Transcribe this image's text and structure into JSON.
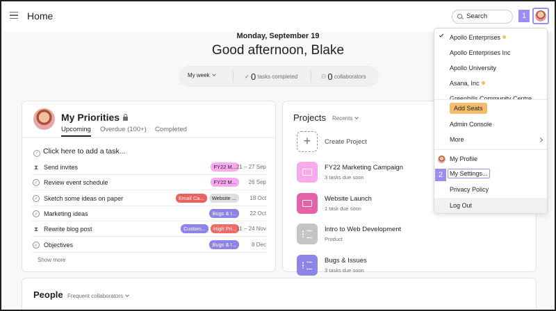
{
  "topbar": {
    "title": "Home",
    "search_label": "Search",
    "step1": "1"
  },
  "header": {
    "date": "Monday, September 19",
    "greeting": "Good afternoon, Blake",
    "week_selector": "My week",
    "tasks_completed_count": "0",
    "tasks_completed_label": "tasks completed",
    "collaborators_count": "0",
    "collaborators_label": "collaborators"
  },
  "priorities": {
    "title": "My Priorities",
    "tabs": [
      "Upcoming",
      "Overdue (100+)",
      "Completed"
    ],
    "add_task": "Click here to add a task...",
    "show_more": "Show more",
    "tasks": [
      {
        "name": "Send invites",
        "icon": "hourglass",
        "tags": [
          {
            "text": "FY22 M...",
            "bg": "#f9aaef"
          }
        ],
        "date": "21 – 27 Sep"
      },
      {
        "name": "Review event schedule",
        "icon": "check-circle",
        "tags": [
          {
            "text": "FY22 M...",
            "bg": "#f9aaef"
          }
        ],
        "date": "26 Sep"
      },
      {
        "name": "Sketch some ideas on paper",
        "icon": "check-circle",
        "tags": [
          {
            "text": "Email Ca...",
            "bg": "#e8625f"
          },
          {
            "text": "Website ...",
            "bg": "#e0dede"
          }
        ],
        "date": "18 Oct"
      },
      {
        "name": "Marketing ideas",
        "icon": "check-circle",
        "tags": [
          {
            "text": "Bugs & I...",
            "bg": "#8d84e8"
          }
        ],
        "date": "22 Oct"
      },
      {
        "name": "Rewrite blog post",
        "icon": "hourglass",
        "tags": [
          {
            "text": "Custom...",
            "bg": "#8d84e8"
          },
          {
            "text": "High Pri...",
            "bg": "#f06a6a"
          }
        ],
        "date": "11 – 24 Nov"
      },
      {
        "name": "Objectives",
        "icon": "check-circle",
        "tags": [
          {
            "text": "Bugs & I...",
            "bg": "#8d84e8"
          }
        ],
        "date": "8 Dec"
      }
    ]
  },
  "projects": {
    "title": "Projects",
    "filter": "Recents",
    "create_label": "Create Project",
    "items": [
      {
        "name": "FY22 Marketing Campaign",
        "sub": "3 tasks due soon",
        "color": "#f9aaef",
        "icon": "calendar"
      },
      {
        "name": "Website Launch",
        "sub": "1 task due soon",
        "color": "#e362a8",
        "icon": "calendar"
      },
      {
        "name": "Intro to Web Development",
        "sub": "Product",
        "color": "#c7c4c4",
        "icon": "list"
      },
      {
        "name": "Bugs & Issues",
        "sub": "3 tasks due soon",
        "color": "#8d84e8",
        "icon": "list"
      }
    ]
  },
  "people": {
    "title": "People",
    "filter": "Frequent collaborators"
  },
  "dropdown": {
    "workspaces": [
      "Apollo Enterprises",
      "Apollo Enterprises Inc",
      "Apollo University",
      "Asana, Inc",
      "Greenhills Community Centre"
    ],
    "add_seats": "Add Seats",
    "admin_console": "Admin Console",
    "more": "More",
    "my_profile": "My Profile",
    "my_settings": "My Settings...",
    "privacy_policy": "Privacy Policy",
    "log_out": "Log Out",
    "step2": "2"
  },
  "colors": {
    "accent": "#9d8cf4",
    "notification_dot": "#f1bd6c"
  }
}
